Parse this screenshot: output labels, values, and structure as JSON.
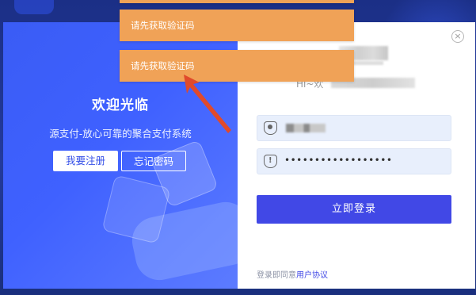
{
  "toasts": [
    {
      "text": "请先获取验证码"
    },
    {
      "text": "请先获取验证码"
    }
  ],
  "promo": {
    "welcome": "欢迎光临",
    "slogan": "源支付-放心可靠的聚合支付系统",
    "register_label": "我要注册",
    "forgot_label": "忘记密码"
  },
  "login": {
    "greeting_prefix": "Hi~欢",
    "password_mask": "••••••••••••••••••",
    "submit_label": "立即登录",
    "agreement_prefix": "登录即同意",
    "agreement_link": "用户协议",
    "close_symbol": "×"
  },
  "colors": {
    "accent": "#4148e6",
    "toast": "#f0a257",
    "promo_blue": "#3f61ff",
    "arrow": "#e04a2b"
  }
}
